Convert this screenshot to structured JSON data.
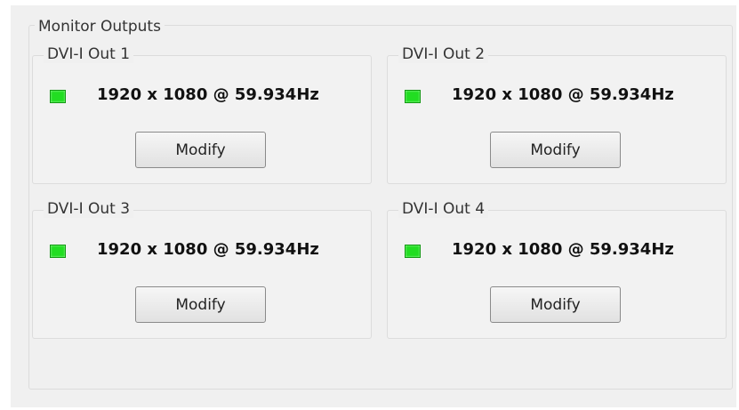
{
  "group": {
    "title": "Monitor Outputs"
  },
  "outputs": [
    {
      "title": "DVI-I Out 1",
      "resolution": "1920 x 1080 @ 59.934Hz",
      "status_color": "#22dd22",
      "button_label": "Modify"
    },
    {
      "title": "DVI-I Out 2",
      "resolution": "1920 x 1080 @ 59.934Hz",
      "status_color": "#22dd22",
      "button_label": "Modify"
    },
    {
      "title": "DVI-I Out 3",
      "resolution": "1920 x 1080 @ 59.934Hz",
      "status_color": "#22dd22",
      "button_label": "Modify"
    },
    {
      "title": "DVI-I Out 4",
      "resolution": "1920 x 1080 @ 59.934Hz",
      "status_color": "#22dd22",
      "button_label": "Modify"
    }
  ]
}
